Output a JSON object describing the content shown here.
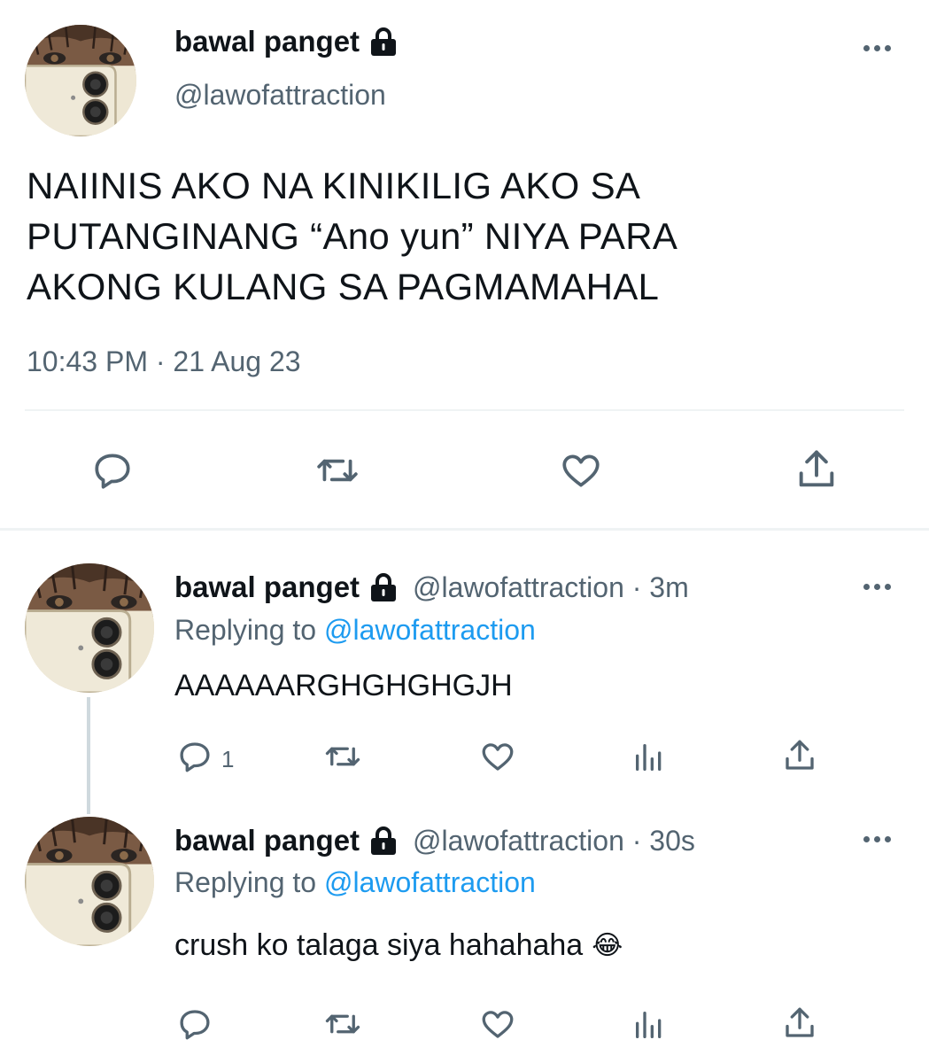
{
  "main_tweet": {
    "display_name": "bawal panget",
    "handle": "@lawofattraction",
    "text_lines": [
      "NAIINIS AKO NA KINIKILIG AKO SA",
      "PUTANGINANG “Ano yun” NIYA PARA",
      "AKONG KULANG SA PAGMAMAHAL"
    ],
    "timestamp": "10:43 PM · 21 Aug 23",
    "actions": [
      "reply-icon",
      "retweet-icon",
      "like-icon",
      "share-icon"
    ]
  },
  "replies": [
    {
      "display_name": "bawal panget",
      "handle_time": "@lawofattraction · 3m",
      "replying_prefix": "Replying to",
      "replying_handle": "@lawofattraction",
      "text": "AAAAAARGHGHGHGJH",
      "reply_count": "1"
    },
    {
      "display_name": "bawal panget",
      "handle_time": "@lawofattraction · 30s",
      "replying_prefix": "Replying to",
      "replying_handle": "@lawofattraction",
      "text": "crush ko talaga siya hahahaha",
      "emoji": "😂"
    }
  ],
  "colors": {
    "text": "#0f1419",
    "secondary": "#536471",
    "link": "#1d9bf0",
    "divider": "#eff3f4"
  }
}
